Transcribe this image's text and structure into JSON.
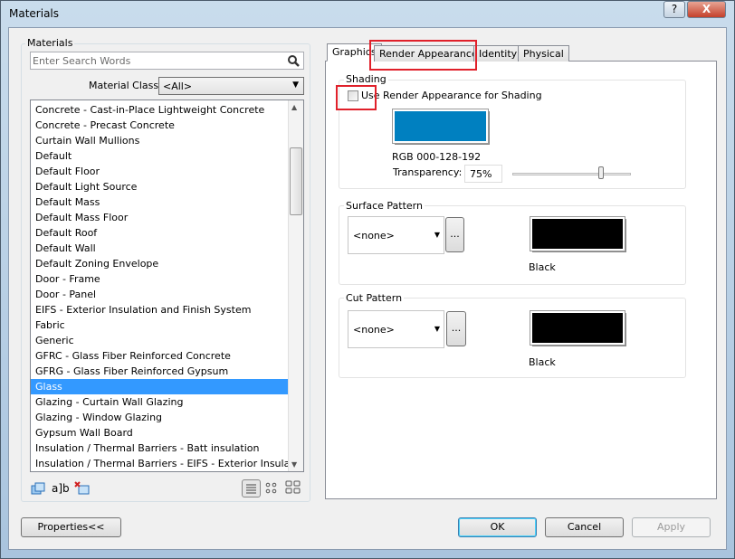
{
  "window": {
    "title": "Materials",
    "help": "?",
    "close": "X"
  },
  "materials": {
    "group_label": "Materials",
    "search_placeholder": "Enter Search Words",
    "class_label": "Material Class:",
    "class_value": "<All>",
    "items": [
      "Concrete - Cast-in-Place Lightweight Concrete",
      "Concrete - Precast Concrete",
      "Curtain Wall Mullions",
      "Default",
      "Default Floor",
      "Default Light Source",
      "Default Mass",
      "Default Mass Floor",
      "Default Roof",
      "Default Wall",
      "Default Zoning Envelope",
      "Door - Frame",
      "Door - Panel",
      "EIFS - Exterior Insulation and Finish System",
      "Fabric",
      "Generic",
      "GFRC -  Glass Fiber Reinforced Concrete",
      "GFRG - Glass Fiber Reinforced Gypsum",
      "Glass",
      "Glazing - Curtain Wall Glazing",
      "Glazing - Window Glazing",
      "Gypsum Wall Board",
      "Insulation / Thermal Barriers - Batt insulation",
      "Insulation / Thermal Barriers - EIFS - Exterior Insulatio..."
    ],
    "selected": "Glass"
  },
  "tabs": [
    "Graphics",
    "Render Appearance",
    "Identity",
    "Physical"
  ],
  "shading": {
    "label": "Shading",
    "checkbox_label": "Use Render Appearance for Shading",
    "checked": false,
    "color": "#0080c0",
    "rgb_text": "RGB 000-128-192",
    "transparency_label": "Transparency:",
    "transparency_value": "75%",
    "transparency_percent": 75
  },
  "surface": {
    "label": "Surface Pattern",
    "pattern": "<none>",
    "more": "...",
    "color_name": "Black",
    "color": "#000000"
  },
  "cut": {
    "label": "Cut Pattern",
    "pattern": "<none>",
    "more": "...",
    "color_name": "Black",
    "color": "#000000"
  },
  "buttons": {
    "properties": "Properties<<",
    "ok": "OK",
    "cancel": "Cancel",
    "apply": "Apply"
  }
}
